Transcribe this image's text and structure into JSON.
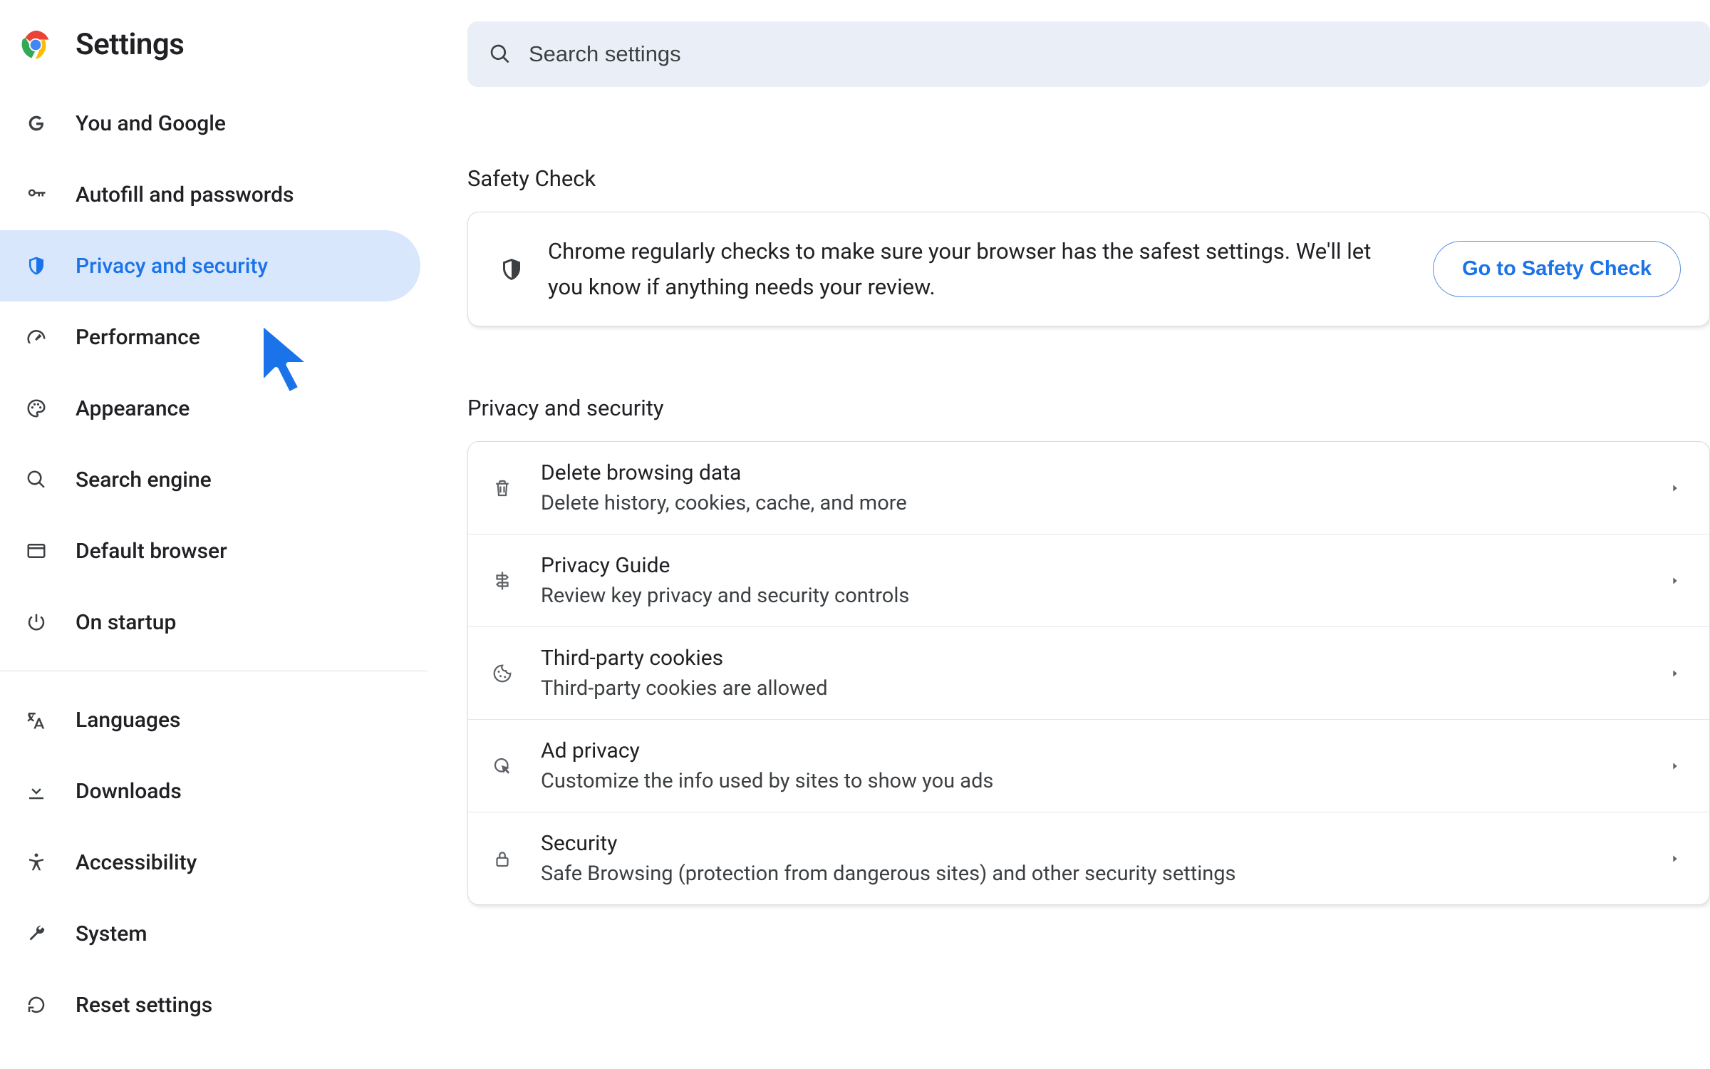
{
  "app": {
    "title": "Settings"
  },
  "search": {
    "placeholder": "Search settings"
  },
  "sidebar": {
    "items": [
      {
        "label": "You and Google",
        "icon": "google-g-icon",
        "active": false
      },
      {
        "label": "Autofill and passwords",
        "icon": "key-icon",
        "active": false
      },
      {
        "label": "Privacy and security",
        "icon": "shield-icon",
        "active": true
      },
      {
        "label": "Performance",
        "icon": "speedometer-icon",
        "active": false
      },
      {
        "label": "Appearance",
        "icon": "palette-icon",
        "active": false
      },
      {
        "label": "Search engine",
        "icon": "search-icon",
        "active": false
      },
      {
        "label": "Default browser",
        "icon": "window-icon",
        "active": false
      },
      {
        "label": "On startup",
        "icon": "power-icon",
        "active": false
      }
    ],
    "secondary": [
      {
        "label": "Languages",
        "icon": "translate-icon"
      },
      {
        "label": "Downloads",
        "icon": "download-icon"
      },
      {
        "label": "Accessibility",
        "icon": "accessibility-icon"
      },
      {
        "label": "System",
        "icon": "wrench-icon"
      },
      {
        "label": "Reset settings",
        "icon": "reset-icon"
      }
    ]
  },
  "sections": {
    "safety": {
      "title": "Safety Check",
      "desc": "Chrome regularly checks to make sure your browser has the safest settings. We'll let you know if anything needs your review.",
      "button": "Go to Safety Check"
    },
    "privacy": {
      "title": "Privacy and security",
      "rows": [
        {
          "title": "Delete browsing data",
          "sub": "Delete history, cookies, cache, and more",
          "icon": "trash-icon"
        },
        {
          "title": "Privacy Guide",
          "sub": "Review key privacy and security controls",
          "icon": "signpost-icon"
        },
        {
          "title": "Third-party cookies",
          "sub": "Third-party cookies are allowed",
          "icon": "cookie-icon"
        },
        {
          "title": "Ad privacy",
          "sub": "Customize the info used by sites to show you ads",
          "icon": "ad-click-icon"
        },
        {
          "title": "Security",
          "sub": "Safe Browsing (protection from dangerous sites) and other security settings",
          "icon": "lock-icon"
        }
      ]
    }
  },
  "colors": {
    "accent": "#1a73e8",
    "active_bg": "#d9e7fd"
  }
}
